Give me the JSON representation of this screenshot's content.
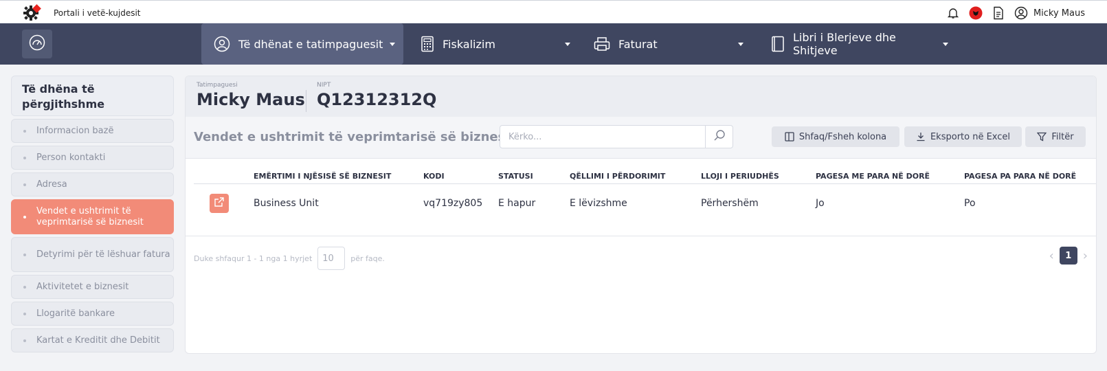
{
  "app": {
    "title": "Portali i vetë-kujdesit",
    "user_name": "Micky Maus"
  },
  "topbar_icons": [
    "bell-icon",
    "albania-flag-icon",
    "document-icon",
    "user-icon"
  ],
  "nav": {
    "items": [
      {
        "label": "Të dhënat e tatimpaguesit",
        "icon": "user-circle-icon",
        "active": true
      },
      {
        "label": "Fiskalizim",
        "icon": "calculator-icon",
        "active": false
      },
      {
        "label": "Faturat",
        "icon": "printer-icon",
        "active": false
      },
      {
        "label": "Libri i Blerjeve dhe Shitjeve",
        "icon": "book-icon",
        "active": false
      }
    ]
  },
  "sidebar": {
    "header": "Të dhëna të përgjithshme",
    "items": [
      {
        "label": "Informacion bazë"
      },
      {
        "label": "Person kontakti"
      },
      {
        "label": "Adresa"
      },
      {
        "label": "Vendet e ushtrimit të veprimtarisë së biznesit",
        "active": true
      },
      {
        "label": "Detyrimi për të lëshuar fatura"
      },
      {
        "label": "Aktivitetet e biznesit"
      },
      {
        "label": "Llogaritë bankare"
      },
      {
        "label": "Kartat e Kreditit dhe Debitit"
      }
    ]
  },
  "taxpayer": {
    "name_label": "Tatimpaguesi",
    "name": "Micky Maus",
    "nipt_label": "NIPT",
    "nipt": "Q12312312Q"
  },
  "toolbar": {
    "title": "Vendet e ushtrimit të veprimtarisë së biznesit",
    "search_placeholder": "Kërko...",
    "columns_btn": "Shfaq/Fsheh kolona",
    "export_btn": "Eksporto në Excel",
    "filter_btn": "Filtër"
  },
  "table": {
    "headers": [
      "EMËRTIMI I NJËSISË SË BIZNESIT",
      "KODI",
      "STATUSI",
      "QËLLIMI I PËRDORIMIT",
      "LLOJI I PERIUDHËS",
      "PAGESA ME PARA NË DORË",
      "PAGESA PA PARA NË DORË"
    ],
    "rows": [
      [
        "Business Unit",
        "vq719zy805",
        "E hapur",
        "E lëvizshme",
        "Përhershëm",
        "Jo",
        "Po"
      ]
    ]
  },
  "pagination": {
    "showing": "Duke shfaqur 1 - 1 nga 1 hyrjet",
    "per_page_value": "10",
    "per_page_suffix": "për faqe.",
    "current_page": "1"
  },
  "colors": {
    "nav_bg": "#3f4660",
    "accent": "#f28b78"
  }
}
